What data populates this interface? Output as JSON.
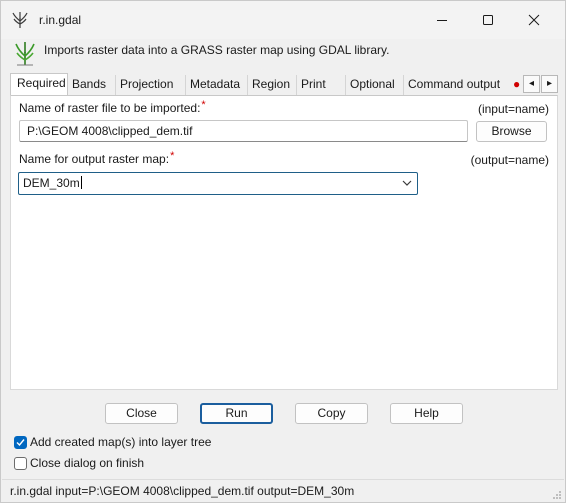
{
  "window": {
    "title": "r.in.gdal",
    "icons": [
      "grass-icon",
      "minimize-icon",
      "maximize-icon",
      "close-icon"
    ]
  },
  "description": "Imports raster data into a GRASS raster map using GDAL library.",
  "tabs": [
    {
      "label": "Required",
      "active": true
    },
    {
      "label": "Bands"
    },
    {
      "label": "Projection"
    },
    {
      "label": "Metadata"
    },
    {
      "label": "Region"
    },
    {
      "label": "Print"
    },
    {
      "label": "Optional"
    },
    {
      "label": "Command output"
    }
  ],
  "tab_scroll": {
    "left": "◂",
    "right": "▸"
  },
  "params": {
    "input": {
      "label": "Name of raster file to be imported:",
      "required_mark": "*",
      "key": "(input=name)",
      "value": "P:\\GEOM 4008\\clipped_dem.tif",
      "browse": "Browse"
    },
    "output": {
      "label": "Name for output raster map:",
      "required_mark": "*",
      "key": "(output=name)",
      "value": "DEM_30m"
    }
  },
  "buttons": {
    "close": "Close",
    "run": "Run",
    "copy": "Copy",
    "help": "Help"
  },
  "options": {
    "add_to_tree": {
      "label": "Add created map(s) into layer tree",
      "checked": true
    },
    "close_on_finish": {
      "label": "Close dialog on finish",
      "checked": false
    }
  },
  "status": "r.in.gdal input=P:\\GEOM 4008\\clipped_dem.tif output=DEM_30m",
  "colors": {
    "accent": "#0067c0",
    "required": "#d00000",
    "focus_border": "#1f5f88"
  }
}
